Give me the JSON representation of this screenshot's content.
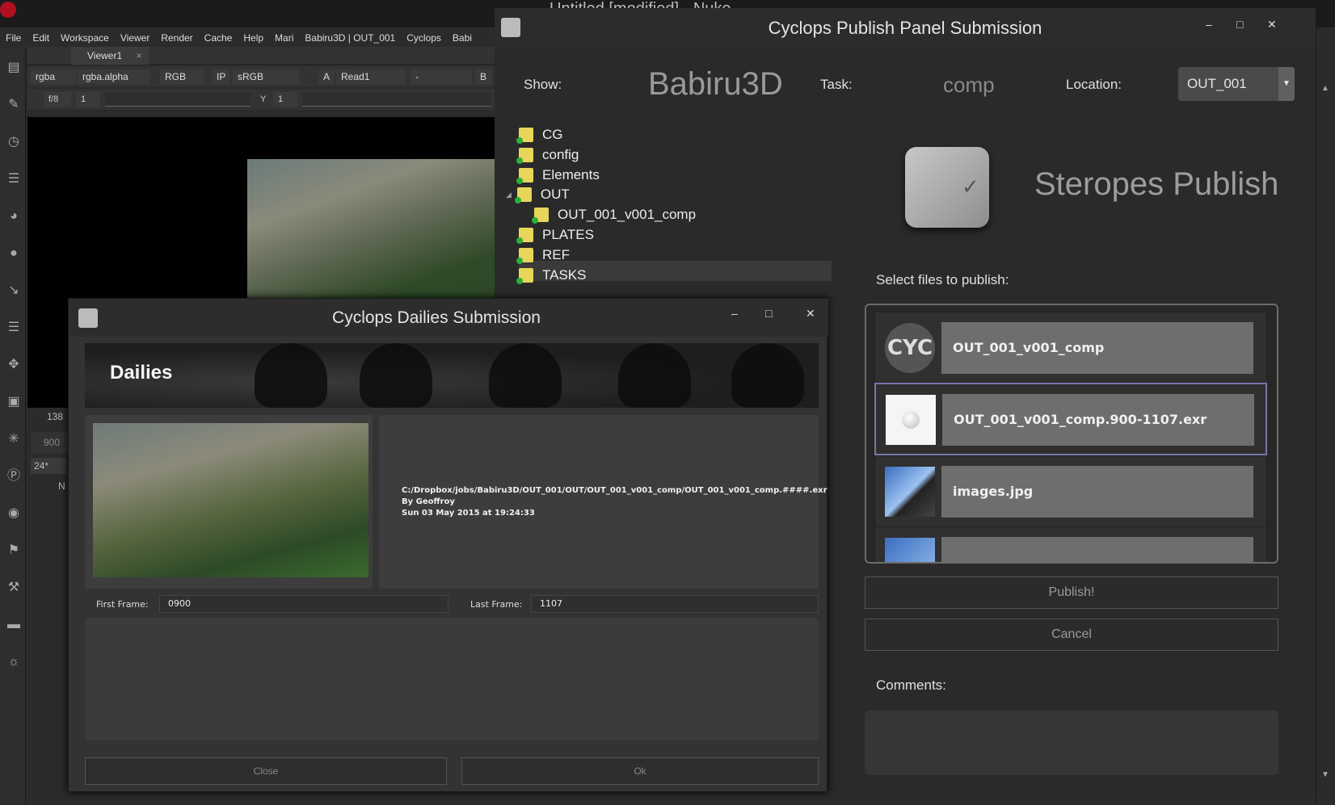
{
  "nuke": {
    "title": "Untitled [modified] - Nuke",
    "menu": [
      "File",
      "Edit",
      "Workspace",
      "Viewer",
      "Render",
      "Cache",
      "Help",
      "Mari",
      "Babiru3D | OUT_001",
      "Cyclops",
      "Babi"
    ],
    "viewer_tab": "Viewer1",
    "viewer_controls": {
      "channels": "rgba",
      "alpha": "rgba.alpha",
      "display": "RGB",
      "ip": "IP",
      "colorspace": "sRGB",
      "a_label": "A",
      "input_a": "Read1",
      "input_b_sep": "-",
      "b_label": "B",
      "fstop": "f/8",
      "gain": "1",
      "y_label": "Y",
      "gamma": "1"
    },
    "side_values": {
      "frame": "138",
      "start": "900",
      "fps": "24*",
      "n": "N"
    }
  },
  "publish_panel": {
    "title": "Cyclops Publish Panel Submission",
    "show_label": "Show:",
    "show_value": "Babiru3D",
    "task_label": "Task:",
    "task_value": "comp",
    "location_label": "Location:",
    "location_value": "OUT_001",
    "tree": [
      {
        "label": "CG",
        "indent": 0
      },
      {
        "label": "config",
        "indent": 0
      },
      {
        "label": "Elements",
        "indent": 0
      },
      {
        "label": "OUT",
        "indent": 0
      },
      {
        "label": "OUT_001_v001_comp",
        "indent": 1
      },
      {
        "label": "PLATES",
        "indent": 0
      },
      {
        "label": "REF",
        "indent": 0
      },
      {
        "label": "TASKS",
        "indent": 0
      }
    ],
    "brand_title": "Steropes Publish",
    "select_label": "Select files to publish:",
    "files": [
      {
        "name": "OUT_001_v001_comp",
        "thumb": "CYC"
      },
      {
        "name": "OUT_001_v001_comp.900-1107.exr",
        "thumb": "exr-ball"
      },
      {
        "name": "images.jpg",
        "thumb": "photo"
      }
    ],
    "publish_button": "Publish!",
    "cancel_button": "Cancel",
    "comments_label": "Comments:"
  },
  "dailies": {
    "title": "Cyclops Dailies Submission",
    "heading": "Dailies",
    "path": "C:/Dropbox/jobs/Babiru3D/OUT_001/OUT/OUT_001_v001_comp/OUT_001_v001_comp.####.exr",
    "author": "By Geoffroy",
    "date": "Sun 03 May 2015 at 19:24:33",
    "first_frame_label": "First Frame:",
    "first_frame_value": "0900",
    "last_frame_label": "Last Frame:",
    "last_frame_value": "1107",
    "close_button": "Close",
    "ok_button": "Ok"
  },
  "colors": {
    "accent_selected": "#7777aa",
    "folder": "#e8d65a",
    "folder_badge": "#2fae3a"
  }
}
